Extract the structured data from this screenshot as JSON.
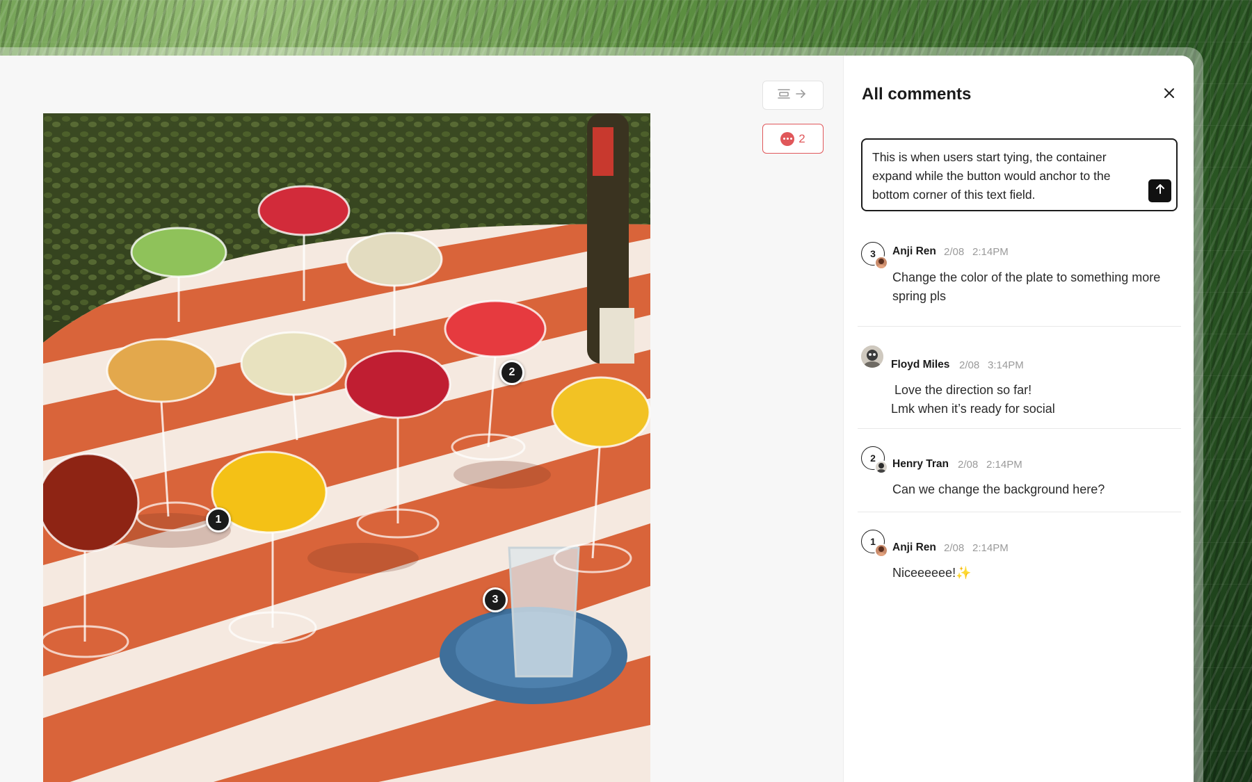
{
  "toolbar": {
    "sidebar_toggle_icon": "collapse-panel-icon",
    "comment_count": "2",
    "comment_icon": "comment-bubble-icon"
  },
  "canvas": {
    "pins": [
      "1",
      "2",
      "3"
    ]
  },
  "panel": {
    "title": "All comments",
    "close_icon": "close-icon",
    "composer": {
      "value": "This is when users start tying, the container expand while the button would anchor to the bottom corner of this text field.",
      "send_icon": "arrow-up-icon"
    },
    "comments": [
      {
        "pin": "3",
        "author": "Anji Ren",
        "date": "2/08",
        "time": "2:14PM",
        "body": "Change the color of the plate to something more spring pls"
      },
      {
        "pin": "",
        "author": "Floyd Miles",
        "date": "2/08",
        "time": "3:14PM",
        "body_line1": " Love the direction so far!",
        "body_line2": "Lmk when it’s ready for social"
      },
      {
        "pin": "2",
        "author": "Henry Tran",
        "date": "2/08",
        "time": "2:14PM",
        "body": "Can we change the background here?"
      },
      {
        "pin": "1",
        "author": "Anji Ren",
        "date": "2/08",
        "time": "2:14PM",
        "body": "Niceeeeee!✨"
      }
    ]
  },
  "colors": {
    "accent_red": "#e0575a",
    "text_dark": "#1a1a1a",
    "meta_gray": "#9a9a9a"
  }
}
